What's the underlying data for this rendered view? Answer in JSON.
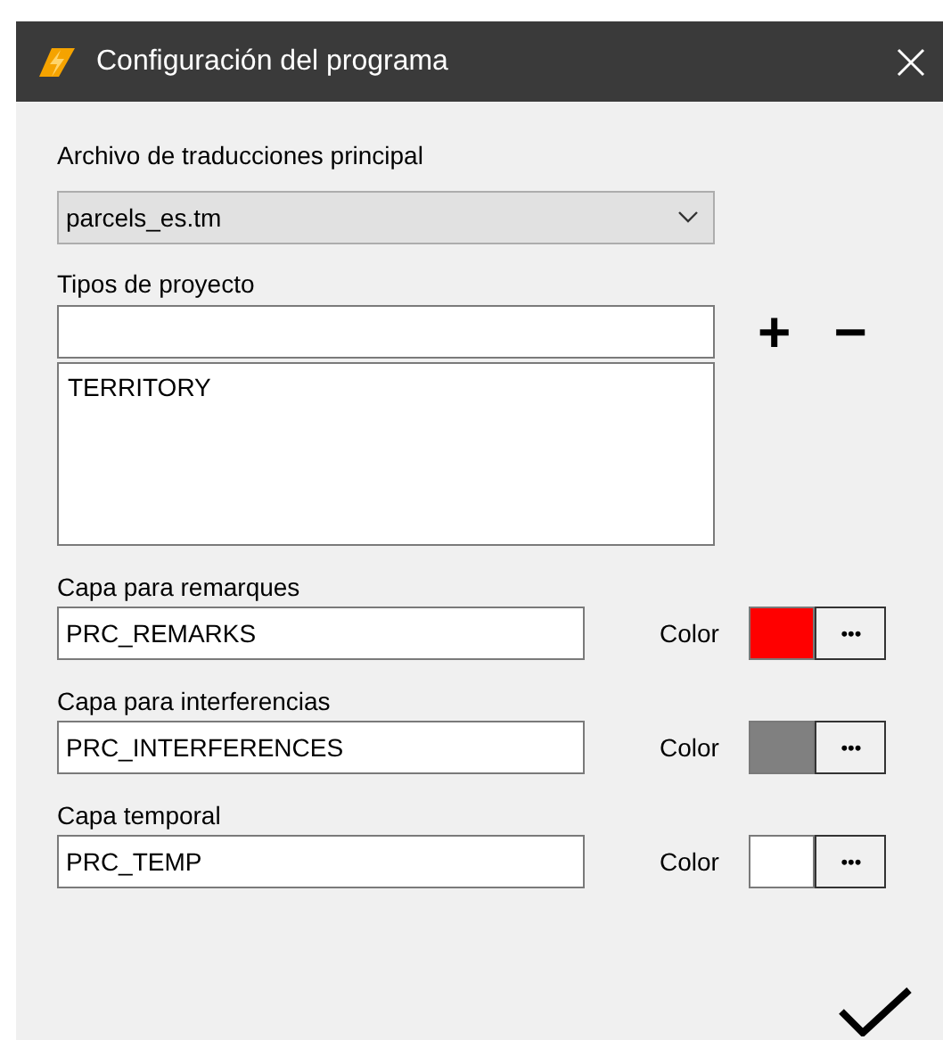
{
  "window": {
    "title": "Configuración del programa"
  },
  "translation_file": {
    "label": "Archivo de traducciones principal",
    "value": "parcels_es.tm"
  },
  "project_types": {
    "label": "Tipos de proyecto",
    "add": "+",
    "remove": "−",
    "items": [
      {
        "text": "TERRITORY"
      }
    ]
  },
  "layers": [
    {
      "label": "Capa para remarques",
      "value": "PRC_REMARKS",
      "color_label": "Color",
      "color": "#ff0000",
      "button": "•••"
    },
    {
      "label": "Capa para interferencias",
      "value": "PRC_INTERFERENCES",
      "color_label": "Color",
      "color": "#808080",
      "button": "•••"
    },
    {
      "label": "Capa temporal",
      "value": "PRC_TEMP",
      "color_label": "Color",
      "color": "#ffffff",
      "button": "•••"
    }
  ]
}
